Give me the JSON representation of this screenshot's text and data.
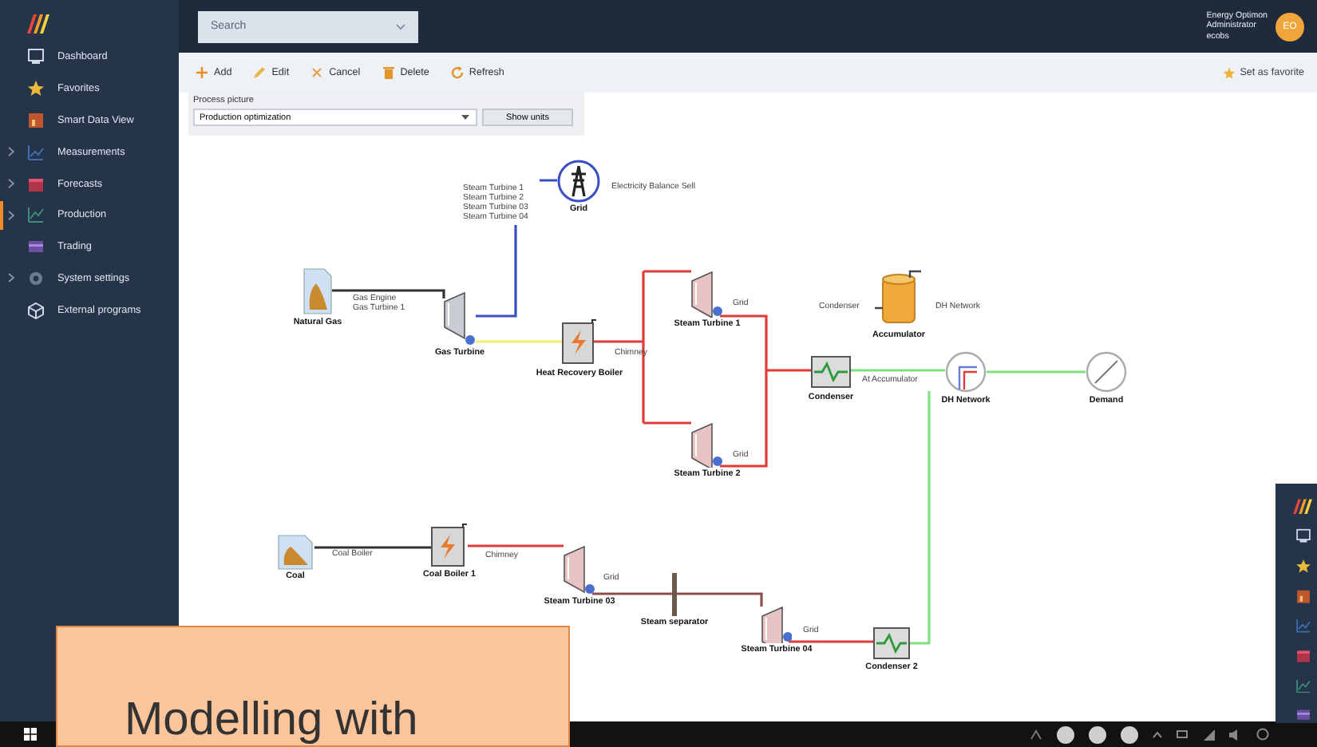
{
  "search": {
    "placeholder": "Search"
  },
  "user": {
    "lines": [
      "Energy Optimon",
      "Administrator",
      "ecobs"
    ],
    "initials": "EO"
  },
  "sidebar": {
    "items": [
      {
        "label": "Dashboard",
        "kind": "dashboard",
        "expandable": false,
        "selected": false
      },
      {
        "label": "Favorites",
        "kind": "favorites",
        "expandable": false,
        "selected": false
      },
      {
        "label": "Smart Data View",
        "kind": "smartdata",
        "expandable": false,
        "selected": false
      },
      {
        "label": "Measurements",
        "kind": "measurements",
        "expandable": true,
        "selected": false
      },
      {
        "label": "Forecasts",
        "kind": "forecasts",
        "expandable": true,
        "selected": false
      },
      {
        "label": "Production",
        "kind": "production",
        "expandable": true,
        "selected": true
      },
      {
        "label": "Trading",
        "kind": "trading",
        "expandable": false,
        "selected": false
      },
      {
        "label": "System settings",
        "kind": "settings",
        "expandable": true,
        "selected": false
      },
      {
        "label": "External programs",
        "kind": "external",
        "expandable": false,
        "selected": false
      }
    ]
  },
  "toolbar": {
    "buttons": [
      {
        "label": "Add",
        "kind": "add"
      },
      {
        "label": "Edit",
        "kind": "edit"
      },
      {
        "label": "Cancel",
        "kind": "cancel"
      },
      {
        "label": "Delete",
        "kind": "delete"
      },
      {
        "label": "Refresh",
        "kind": "refresh"
      }
    ],
    "favorite": "Set as favorite"
  },
  "process_picture": {
    "label": "Process picture",
    "value": "Production optimization",
    "button": "Show units"
  },
  "diagram": {
    "nodes": [
      {
        "kind": "grid",
        "label": "Grid"
      },
      {
        "kind": "fuel",
        "label": "Natural Gas"
      },
      {
        "kind": "gas_turbine",
        "label": "Gas Turbine"
      },
      {
        "kind": "boiler",
        "label": "Heat Recovery Boiler"
      },
      {
        "kind": "steam_turbine",
        "label": "Steam Turbine 1"
      },
      {
        "kind": "accumulator",
        "label": "Accumulator"
      },
      {
        "kind": "condenser",
        "label": "Condenser"
      },
      {
        "kind": "network",
        "label": "DH Network"
      },
      {
        "kind": "demand",
        "label": "Demand"
      },
      {
        "kind": "steam_turbine",
        "label": "Steam Turbine 2"
      },
      {
        "kind": "fuel",
        "label": "Coal"
      },
      {
        "kind": "boiler",
        "label": "Coal Boiler 1"
      },
      {
        "kind": "steam_turbine",
        "label": "Steam Turbine 03"
      },
      {
        "kind": "separator",
        "label": "Steam separator"
      },
      {
        "kind": "steam_turbine",
        "label": "Steam Turbine 04"
      },
      {
        "kind": "condenser",
        "label": "Condenser 2"
      }
    ],
    "annotations": [
      "Steam Turbine 1",
      "Steam Turbine 2",
      "Steam Turbine 03",
      "Steam Turbine 04",
      "Electricity Balance Sell",
      "Gas Engine",
      "Gas Turbine 1",
      "Chimney",
      "Grid",
      "Condenser",
      "DH Network",
      "Grid",
      "At Accumulator",
      "Coal Boiler",
      "Chimney",
      "Grid",
      "Grid"
    ]
  },
  "callout": {
    "text": "Modelling with"
  }
}
